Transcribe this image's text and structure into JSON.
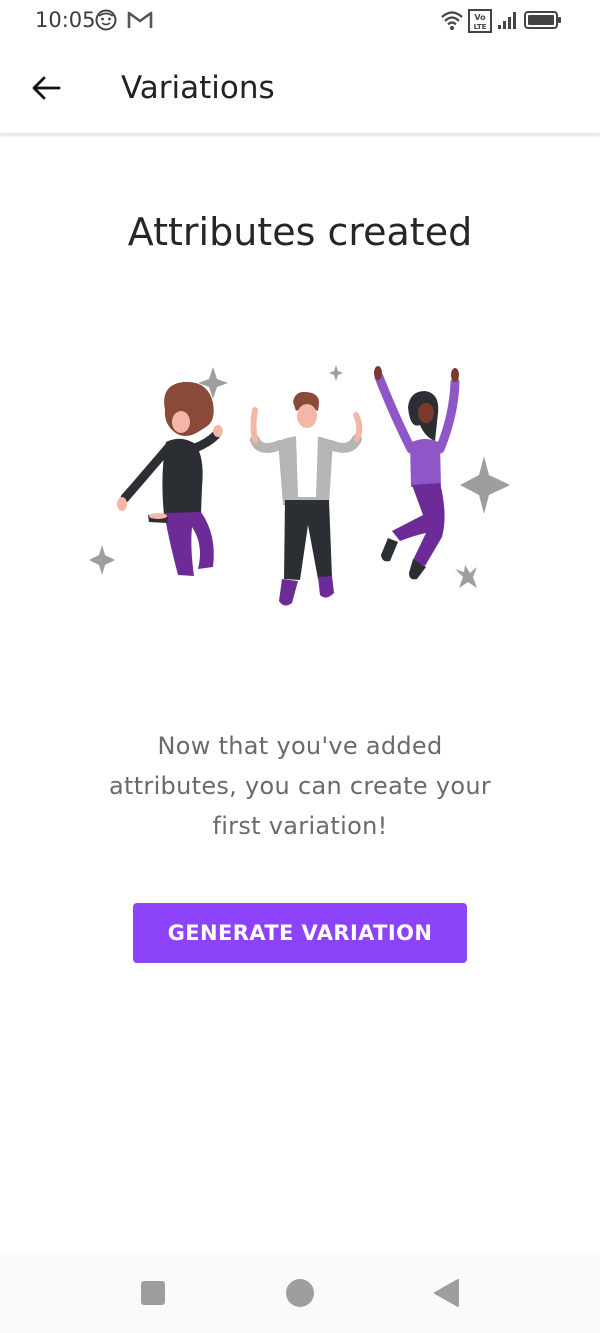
{
  "status_bar": {
    "time": "10:05",
    "icons": [
      "face-icon",
      "gmail-icon",
      "wifi-icon",
      "volte-icon",
      "signal-icon",
      "battery-icon"
    ]
  },
  "app_bar": {
    "title": "Variations",
    "back_icon": "arrow-left-icon"
  },
  "main": {
    "heading": "Attributes created",
    "illustration": "celebrating-people-illustration",
    "description": "Now that you've added attributes, you can create your first variation!",
    "button_label": "GENERATE VARIATION"
  },
  "nav_bar": {
    "icons": [
      "recent-apps-icon",
      "home-icon",
      "back-icon"
    ]
  },
  "colors": {
    "accent": "#8d43f9",
    "heading_text": "#262626",
    "body_text": "#6a6a6a",
    "illustration_purple": "#7b3fb0",
    "illustration_gray": "#9e9e9e"
  }
}
